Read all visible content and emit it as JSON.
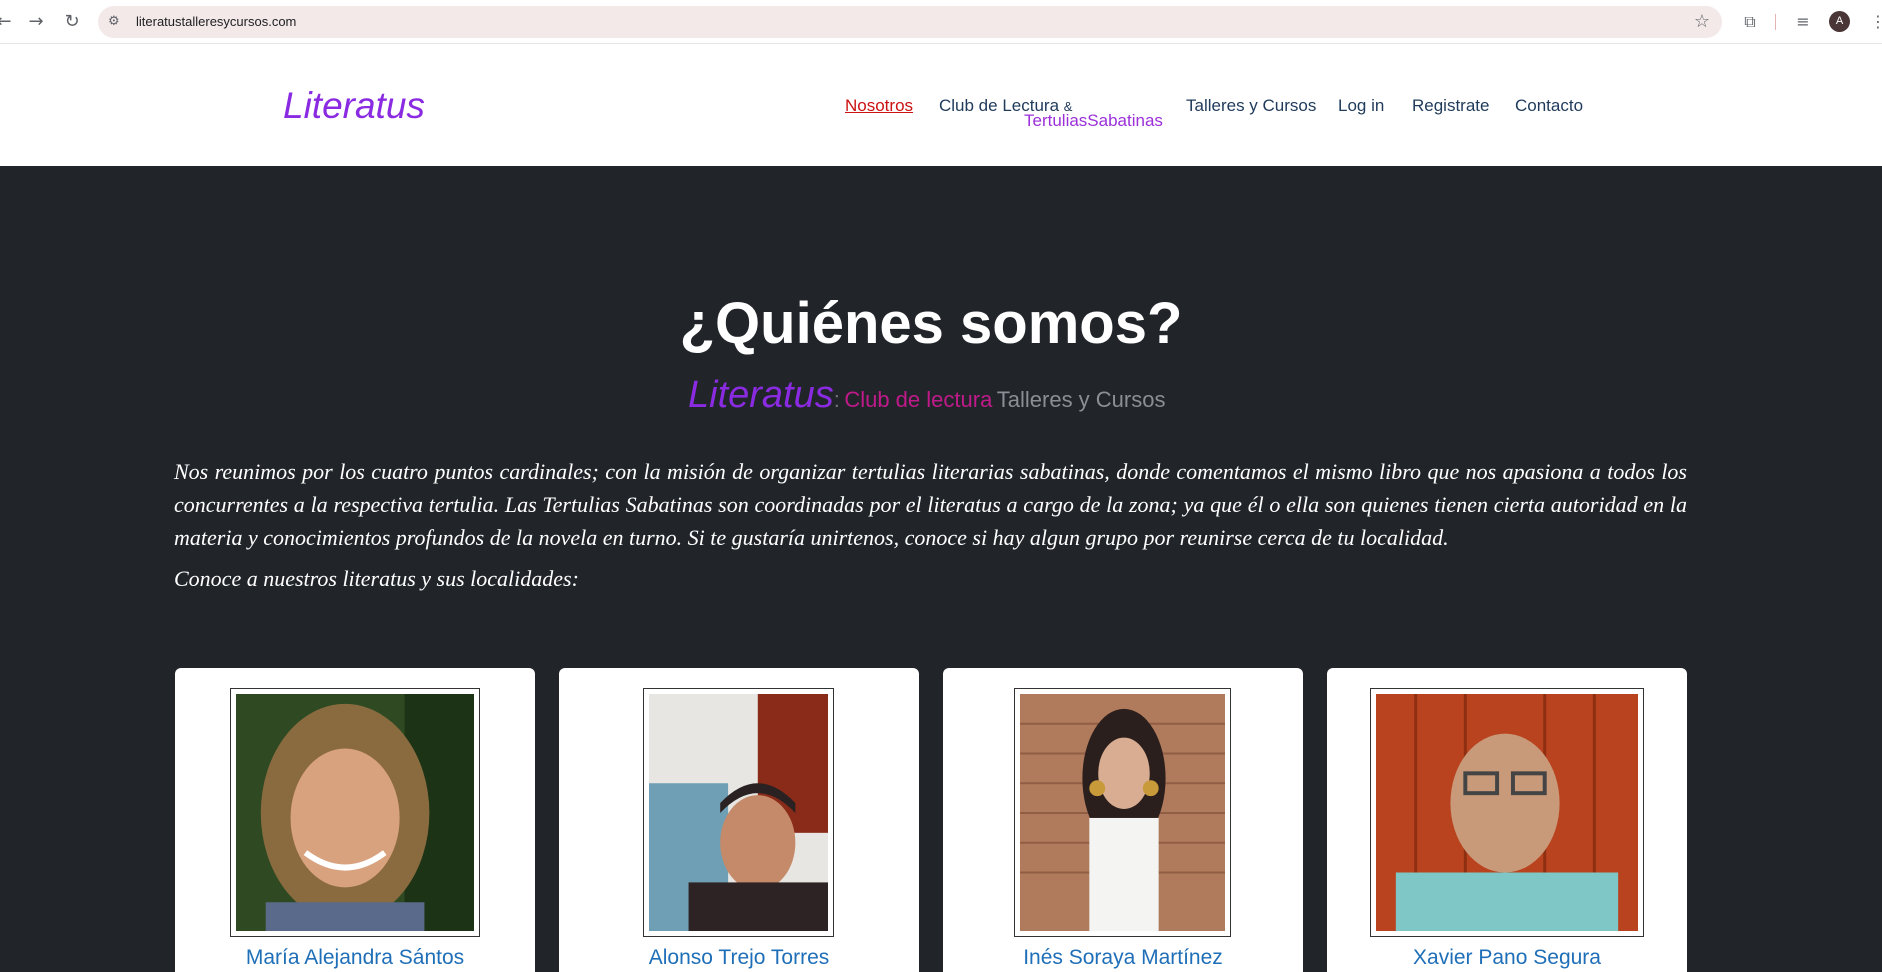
{
  "browser": {
    "url": "literatustalleresycursos.com",
    "avatar_initial": "A",
    "icons": [
      "back-icon",
      "forward-icon",
      "reload-icon",
      "site-info-icon",
      "bookmark-star-icon",
      "extensions-icon",
      "media-icon",
      "menu-icon"
    ]
  },
  "site": {
    "brand": "Literatus",
    "nav": {
      "nosotros": "Nosotros",
      "club_top": "Club de Lectura",
      "club_amp": "&",
      "club_sub": "TertuliasSabatinas",
      "talleres": "Talleres y Cursos",
      "login": "Log in",
      "registrate": "Registrate",
      "contacto": "Contacto"
    }
  },
  "hero": {
    "title": "¿Quiénes somos?",
    "tagline_brand": "Literatus",
    "tagline_colon": ":",
    "tagline_club": "Club de lectura",
    "tagline_talleres": "Talleres y Cursos",
    "intro": "Nos reunimos por los cuatro puntos cardinales; con la misión de organizar tertulias literarias sabatinas, donde comentamos el mismo libro que nos apasiona a todos los concurrentes a la respectiva tertulia. Las Tertulias Sabatinas son coordinadas por el literatus a cargo de la zona; ya que él o ella son quienes tienen cierta autoridad en la materia y conocimientos profundos de la novela en turno. Si te gustaría unirtenos, conoce si hay algun grupo por reunirse cerca de tu localidad.",
    "intro2": "Conoce a nuestros literatus y sus localidades:"
  },
  "cards": [
    {
      "name": "María Alejandra Sántos"
    },
    {
      "name": "Alonso Trejo Torres"
    },
    {
      "name": "Inés Soraya Martínez"
    },
    {
      "name": "Xavier Pano Segura"
    }
  ],
  "colors": {
    "brand_purple": "#8a2be2",
    "nav_text": "#1f3a5a",
    "nav_active": "#cc1111",
    "hero_bg": "#212529",
    "name_link": "#1f6fb8"
  }
}
